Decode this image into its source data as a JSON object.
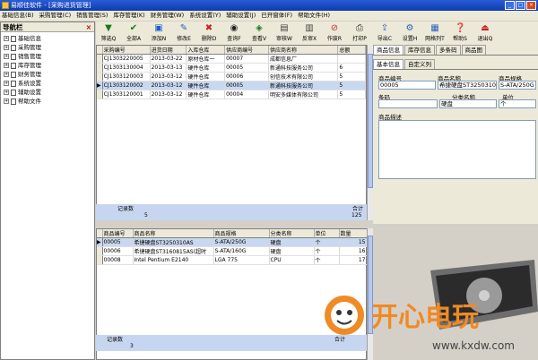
{
  "window": {
    "title": "易顺佳软件 - [采购进货管理]"
  },
  "menu": [
    "基础信息(B)",
    "采购管理(C)",
    "销售管理(S)",
    "库存管理(K)",
    "财务管理(W)",
    "系统设置(Y)",
    "辅助设置(J)",
    "已开窗体(F)",
    "帮助文件(H)"
  ],
  "nav": {
    "title": "导航栏",
    "items": [
      "基础信息",
      "采购管理",
      "销售管理",
      "库存管理",
      "财务管理",
      "系统设置",
      "辅助设置",
      "帮助文件"
    ]
  },
  "toolbar": [
    {
      "label": "筛选Q",
      "icon": "filter-icon"
    },
    {
      "label": "全部A",
      "icon": "check-all-icon"
    },
    {
      "label": "添加N",
      "icon": "add-icon"
    },
    {
      "label": "修改E",
      "icon": "edit-icon"
    },
    {
      "label": "删除D",
      "icon": "delete-icon"
    },
    {
      "label": "查询F",
      "icon": "search-icon"
    },
    {
      "label": "查看V",
      "icon": "view-icon"
    },
    {
      "label": "审核W",
      "icon": "approve-icon"
    },
    {
      "label": "反审X",
      "icon": "unapprove-icon"
    },
    {
      "label": "作废R",
      "icon": "void-icon"
    },
    {
      "label": "打印P",
      "icon": "print-icon"
    },
    {
      "label": "导出C",
      "icon": "export-icon"
    },
    {
      "label": "设置H",
      "icon": "settings-icon"
    },
    {
      "label": "网格列T",
      "icon": "columns-icon"
    },
    {
      "label": "帮助S",
      "icon": "help-icon"
    },
    {
      "label": "退出Q",
      "icon": "exit-icon"
    }
  ],
  "orders": {
    "headers": [
      "采购编号",
      "进货日期",
      "入库仓库",
      "供应商编号",
      "供应商名称",
      "总额"
    ],
    "rows": [
      [
        "CJ1303220005",
        "2013-03-22",
        "原材仓库一",
        "00007",
        "成都信息厂",
        ""
      ],
      [
        "CJ1303130004",
        "2013-03-13",
        "硬件仓库",
        "00005",
        "新通科技服务公司",
        "6"
      ],
      [
        "CJ1303120003",
        "2013-03-12",
        "硬件仓库",
        "00006",
        "创信技术有限公司",
        "5"
      ],
      [
        "CJ1303120002",
        "2013-03-12",
        "硬件仓库",
        "00005",
        "新通科技服务公司",
        "5"
      ],
      [
        "CJ1303120001",
        "2013-03-12",
        "硬件仓库",
        "00004",
        "明安多媒体有限公司",
        "5"
      ]
    ],
    "summary_label": "记录数",
    "summary_count": "5",
    "total_label": "合计",
    "total_value": "125"
  },
  "details": {
    "headers": [
      "商品编号",
      "商品名称",
      "商品规格",
      "分类名称",
      "单位",
      "数量"
    ],
    "rows": [
      [
        "00005",
        "希捷硬盘ST3250310AS",
        "S-ATA/250G",
        "硬盘",
        "个",
        "15"
      ],
      [
        "00006",
        "希捷硬盘ST3160815AS(超时",
        "S-ATA/160G",
        "硬盘",
        "个",
        "16"
      ],
      [
        "00008",
        "Intel Pentium E2140",
        "LGA 775",
        "CPU",
        "个",
        "17"
      ]
    ],
    "summary_label": "记录数",
    "summary_count": "3",
    "total_label": "合计"
  },
  "right_panel": {
    "tabs": [
      "商品信息",
      "库存信息",
      "多条码",
      "商品图"
    ],
    "subtabs": [
      "基本信息",
      "自定义列"
    ],
    "labels": {
      "code": "商品编号",
      "name": "商品名称",
      "spec": "商品规格",
      "barcode": "条码",
      "category": "分类名称",
      "unit": "单位",
      "desc": "商品描述"
    },
    "values": {
      "code": "00005",
      "name": "希捷硬盘ST3250310/",
      "spec": "S-ATA/250G",
      "barcode": "",
      "category": "硬盘",
      "unit": "个"
    }
  },
  "watermark": {
    "text": "开心电玩",
    "url": "www.kxdw.com"
  }
}
